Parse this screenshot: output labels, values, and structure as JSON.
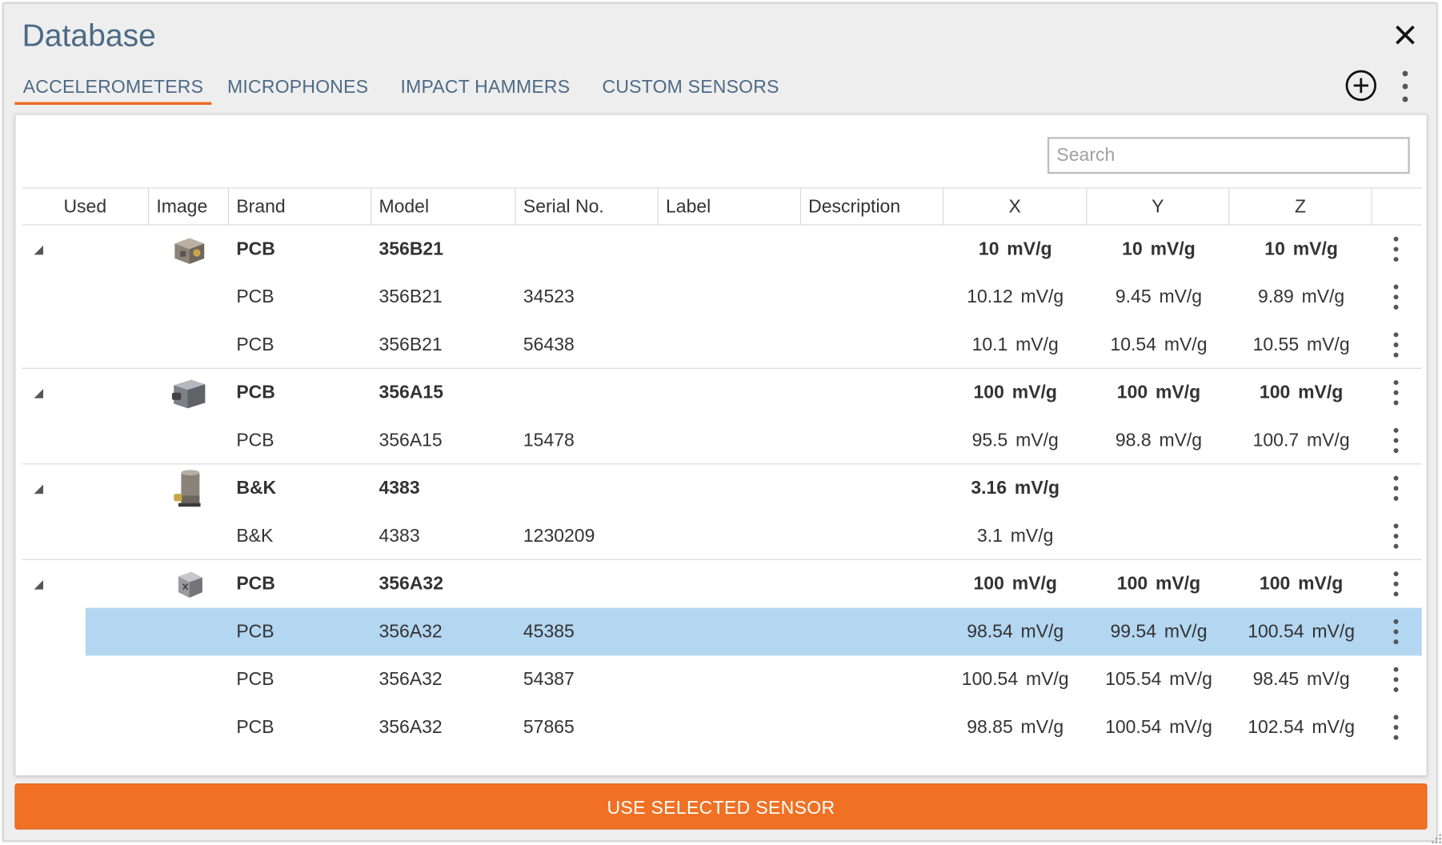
{
  "dialog": {
    "title": "Database"
  },
  "tabs": [
    {
      "label": "ACCELEROMETERS",
      "active": true
    },
    {
      "label": "MICROPHONES",
      "active": false
    },
    {
      "label": "IMPACT HAMMERS",
      "active": false
    },
    {
      "label": "CUSTOM SENSORS",
      "active": false
    }
  ],
  "search": {
    "placeholder": "Search",
    "value": ""
  },
  "columns": [
    "Used",
    "Image",
    "Brand",
    "Model",
    "Serial No.",
    "Label",
    "Description",
    "X",
    "Y",
    "Z"
  ],
  "groups": [
    {
      "brand": "PCB",
      "model": "356B21",
      "x": "10 mV/g",
      "y": "10 mV/g",
      "z": "10 mV/g",
      "image": "accelerometer-cube",
      "items": [
        {
          "brand": "PCB",
          "model": "356B21",
          "serial": "34523",
          "x": "10.12 mV/g",
          "y": "9.45 mV/g",
          "z": "9.89 mV/g"
        },
        {
          "brand": "PCB",
          "model": "356B21",
          "serial": "56438",
          "x": "10.1 mV/g",
          "y": "10.54 mV/g",
          "z": "10.55 mV/g"
        }
      ]
    },
    {
      "brand": "PCB",
      "model": "356A15",
      "x": "100 mV/g",
      "y": "100 mV/g",
      "z": "100 mV/g",
      "image": "accelerometer-box",
      "items": [
        {
          "brand": "PCB",
          "model": "356A15",
          "serial": "15478",
          "x": "95.5 mV/g",
          "y": "98.8 mV/g",
          "z": "100.7 mV/g"
        }
      ]
    },
    {
      "brand": "B&K",
      "model": "4383",
      "x": "3.16 mV/g",
      "y": "",
      "z": "",
      "image": "accelerometer-cylinder",
      "items": [
        {
          "brand": "B&K",
          "model": "4383",
          "serial": "1230209",
          "x": "3.1 mV/g",
          "y": "",
          "z": ""
        }
      ]
    },
    {
      "brand": "PCB",
      "model": "356A32",
      "x": "100 mV/g",
      "y": "100 mV/g",
      "z": "100 mV/g",
      "image": "accelerometer-small-cube",
      "items": [
        {
          "brand": "PCB",
          "model": "356A32",
          "serial": "45385",
          "x": "98.54 mV/g",
          "y": "99.54 mV/g",
          "z": "100.54 mV/g",
          "selected": true
        },
        {
          "brand": "PCB",
          "model": "356A32",
          "serial": "54387",
          "x": "100.54 mV/g",
          "y": "105.54 mV/g",
          "z": "98.45 mV/g"
        },
        {
          "brand": "PCB",
          "model": "356A32",
          "serial": "57865",
          "x": "98.85 mV/g",
          "y": "100.54 mV/g",
          "z": "102.54 mV/g"
        }
      ]
    }
  ],
  "footer": {
    "button_label": "USE SELECTED SENSOR"
  },
  "colors": {
    "accent": "#f07124",
    "title": "#4d6a86",
    "selection": "#b3d6f1"
  }
}
